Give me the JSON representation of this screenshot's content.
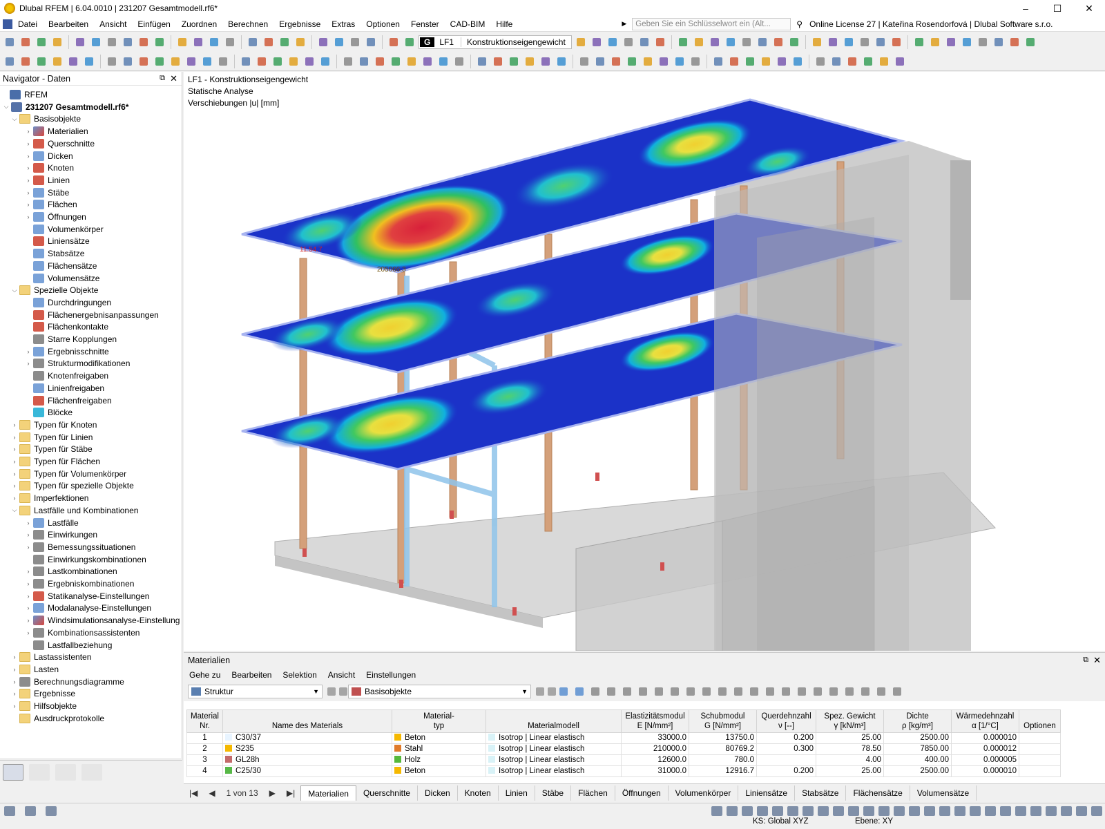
{
  "window": {
    "title": "Dlubal RFEM | 6.04.0010 | 231207 Gesamtmodell.rf6*",
    "controls": [
      "–",
      "☐",
      "✕"
    ]
  },
  "menu": [
    "Datei",
    "Bearbeiten",
    "Ansicht",
    "Einfügen",
    "Zuordnen",
    "Berechnen",
    "Ergebnisse",
    "Extras",
    "Optionen",
    "Fenster",
    "CAD-BIM",
    "Hilfe"
  ],
  "search": {
    "placeholder": "Geben Sie ein Schlüsselwort ein (Alt..."
  },
  "license": "Online License 27 | Kateřina Rosendorfová | Dlubal Software s.r.o.",
  "loadcase": {
    "tag": "G",
    "code": "LF1",
    "name": "Konstruktionseigengewicht"
  },
  "navigator": {
    "title": "Navigator - Daten",
    "items": [
      {
        "label": "RFEM",
        "level": 0,
        "exp": "",
        "icon": "rfem"
      },
      {
        "label": "231207 Gesamtmodell.rf6*",
        "level": 0,
        "exp": "v",
        "icon": "file",
        "bold": true
      },
      {
        "label": "Basisobjekte",
        "level": 1,
        "exp": "v",
        "icon": "folder"
      },
      {
        "label": "Materialien",
        "level": 2,
        "exp": ">",
        "icon": "std"
      },
      {
        "label": "Querschnitte",
        "level": 2,
        "exp": ">",
        "icon": "red"
      },
      {
        "label": "Dicken",
        "level": 2,
        "exp": ">",
        "icon": "blu"
      },
      {
        "label": "Knoten",
        "level": 2,
        "exp": ">",
        "icon": "red"
      },
      {
        "label": "Linien",
        "level": 2,
        "exp": ">",
        "icon": "red"
      },
      {
        "label": "Stäbe",
        "level": 2,
        "exp": ">",
        "icon": "blu"
      },
      {
        "label": "Flächen",
        "level": 2,
        "exp": ">",
        "icon": "blu"
      },
      {
        "label": "Öffnungen",
        "level": 2,
        "exp": ">",
        "icon": "blu"
      },
      {
        "label": "Volumenkörper",
        "level": 2,
        "exp": "",
        "icon": "blu"
      },
      {
        "label": "Liniensätze",
        "level": 2,
        "exp": "",
        "icon": "red"
      },
      {
        "label": "Stabsätze",
        "level": 2,
        "exp": "",
        "icon": "blu"
      },
      {
        "label": "Flächensätze",
        "level": 2,
        "exp": "",
        "icon": "blu"
      },
      {
        "label": "Volumensätze",
        "level": 2,
        "exp": "",
        "icon": "blu"
      },
      {
        "label": "Spezielle Objekte",
        "level": 1,
        "exp": "v",
        "icon": "folder"
      },
      {
        "label": "Durchdringungen",
        "level": 2,
        "exp": "",
        "icon": "blu"
      },
      {
        "label": "Flächenergebnisanpassungen",
        "level": 2,
        "exp": "",
        "icon": "red"
      },
      {
        "label": "Flächenkontakte",
        "level": 2,
        "exp": "",
        "icon": "red"
      },
      {
        "label": "Starre Kopplungen",
        "level": 2,
        "exp": "",
        "icon": "gry"
      },
      {
        "label": "Ergebnisschnitte",
        "level": 2,
        "exp": ">",
        "icon": "blu"
      },
      {
        "label": "Strukturmodifikationen",
        "level": 2,
        "exp": ">",
        "icon": "gry"
      },
      {
        "label": "Knotenfreigaben",
        "level": 2,
        "exp": "",
        "icon": "gry"
      },
      {
        "label": "Linienfreigaben",
        "level": 2,
        "exp": "",
        "icon": "blu"
      },
      {
        "label": "Flächenfreigaben",
        "level": 2,
        "exp": "",
        "icon": "red"
      },
      {
        "label": "Blöcke",
        "level": 2,
        "exp": "",
        "icon": "cyn"
      },
      {
        "label": "Typen für Knoten",
        "level": 1,
        "exp": ">",
        "icon": "folder"
      },
      {
        "label": "Typen für Linien",
        "level": 1,
        "exp": ">",
        "icon": "folder"
      },
      {
        "label": "Typen für Stäbe",
        "level": 1,
        "exp": ">",
        "icon": "folder"
      },
      {
        "label": "Typen für Flächen",
        "level": 1,
        "exp": ">",
        "icon": "folder"
      },
      {
        "label": "Typen für Volumenkörper",
        "level": 1,
        "exp": ">",
        "icon": "folder"
      },
      {
        "label": "Typen für spezielle Objekte",
        "level": 1,
        "exp": ">",
        "icon": "folder"
      },
      {
        "label": "Imperfektionen",
        "level": 1,
        "exp": ">",
        "icon": "folder"
      },
      {
        "label": "Lastfälle und Kombinationen",
        "level": 1,
        "exp": "v",
        "icon": "folder"
      },
      {
        "label": "Lastfälle",
        "level": 2,
        "exp": ">",
        "icon": "blu"
      },
      {
        "label": "Einwirkungen",
        "level": 2,
        "exp": ">",
        "icon": "gry"
      },
      {
        "label": "Bemessungssituationen",
        "level": 2,
        "exp": ">",
        "icon": "gry"
      },
      {
        "label": "Einwirkungskombinationen",
        "level": 2,
        "exp": "",
        "icon": "gry"
      },
      {
        "label": "Lastkombinationen",
        "level": 2,
        "exp": ">",
        "icon": "gry"
      },
      {
        "label": "Ergebniskombinationen",
        "level": 2,
        "exp": ">",
        "icon": "gry"
      },
      {
        "label": "Statikanalyse-Einstellungen",
        "level": 2,
        "exp": ">",
        "icon": "red"
      },
      {
        "label": "Modalanalyse-Einstellungen",
        "level": 2,
        "exp": ">",
        "icon": "blu"
      },
      {
        "label": "Windsimulationsanalyse-Einstellung",
        "level": 2,
        "exp": ">",
        "icon": "std"
      },
      {
        "label": "Kombinationsassistenten",
        "level": 2,
        "exp": ">",
        "icon": "gry"
      },
      {
        "label": "Lastfallbeziehung",
        "level": 2,
        "exp": "",
        "icon": "gry"
      },
      {
        "label": "Lastassistenten",
        "level": 1,
        "exp": ">",
        "icon": "folder"
      },
      {
        "label": "Lasten",
        "level": 1,
        "exp": ">",
        "icon": "folder"
      },
      {
        "label": "Berechnungsdiagramme",
        "level": 1,
        "exp": ">",
        "icon": "gry"
      },
      {
        "label": "Ergebnisse",
        "level": 1,
        "exp": ">",
        "icon": "folder"
      },
      {
        "label": "Hilfsobjekte",
        "level": 1,
        "exp": ">",
        "icon": "folder"
      },
      {
        "label": "Ausdruckprotokolle",
        "level": 1,
        "exp": "",
        "icon": "folder"
      }
    ]
  },
  "viewport": {
    "line1": "LF1 - Konstruktionseigengewicht",
    "line2": "Statische Analyse",
    "line3": "Verschiebungen |u| [mm]",
    "label_max": "205066.3",
    "label_min": "11.54.7"
  },
  "materials": {
    "title": "Materialien",
    "menu": [
      "Gehe zu",
      "Bearbeiten",
      "Selektion",
      "Ansicht",
      "Einstellungen"
    ],
    "combo1": "Struktur",
    "combo2": "Basisobjekte",
    "headers": [
      [
        "Material",
        "Nr."
      ],
      [
        "Name des Materials"
      ],
      [
        "Material-",
        "typ"
      ],
      [
        "Materialmodell"
      ],
      [
        "Elastizitätsmodul",
        "E [N/mm²]"
      ],
      [
        "Schubmodul",
        "G [N/mm²]"
      ],
      [
        "Querdehnzahl",
        "ν [--]"
      ],
      [
        "Spez. Gewicht",
        "γ [kN/m³]"
      ],
      [
        "Dichte",
        "ρ [kg/m³]"
      ],
      [
        "Wärmedehnzahl",
        "α [1/°C]"
      ],
      [
        "Optionen"
      ]
    ],
    "rows": [
      {
        "nr": "1",
        "name": "C30/37",
        "color": "#e8f4ff",
        "typ": "Beton",
        "typcolor": "#f5b800",
        "model": "Isotrop | Linear elastisch",
        "E": "33000.0",
        "G": "13750.0",
        "nu": "0.200",
        "gamma": "25.00",
        "rho": "2500.00",
        "alpha": "0.000010"
      },
      {
        "nr": "2",
        "name": "S235",
        "color": "#f5b800",
        "typ": "Stahl",
        "typcolor": "#e07a2a",
        "model": "Isotrop | Linear elastisch",
        "E": "210000.0",
        "G": "80769.2",
        "nu": "0.300",
        "gamma": "78.50",
        "rho": "7850.00",
        "alpha": "0.000012"
      },
      {
        "nr": "3",
        "name": "GL28h",
        "color": "#c46a6a",
        "typ": "Holz",
        "typcolor": "#56b83a",
        "model": "Isotrop | Linear elastisch",
        "E": "12600.0",
        "G": "780.0",
        "nu": "",
        "gamma": "4.00",
        "rho": "400.00",
        "alpha": "0.000005"
      },
      {
        "nr": "4",
        "name": "C25/30",
        "color": "#57b847",
        "typ": "Beton",
        "typcolor": "#f5b800",
        "model": "Isotrop | Linear elastisch",
        "E": "31000.0",
        "G": "12916.7",
        "nu": "0.200",
        "gamma": "25.00",
        "rho": "2500.00",
        "alpha": "0.000010"
      }
    ]
  },
  "tabs": {
    "pager": "1 von 13",
    "items": [
      "Materialien",
      "Querschnitte",
      "Dicken",
      "Knoten",
      "Linien",
      "Stäbe",
      "Flächen",
      "Öffnungen",
      "Volumenkörper",
      "Liniensätze",
      "Stabsätze",
      "Flächensätze",
      "Volumensätze"
    ]
  },
  "status": {
    "ks": "KS: Global XYZ",
    "ebene": "Ebene: XY"
  }
}
